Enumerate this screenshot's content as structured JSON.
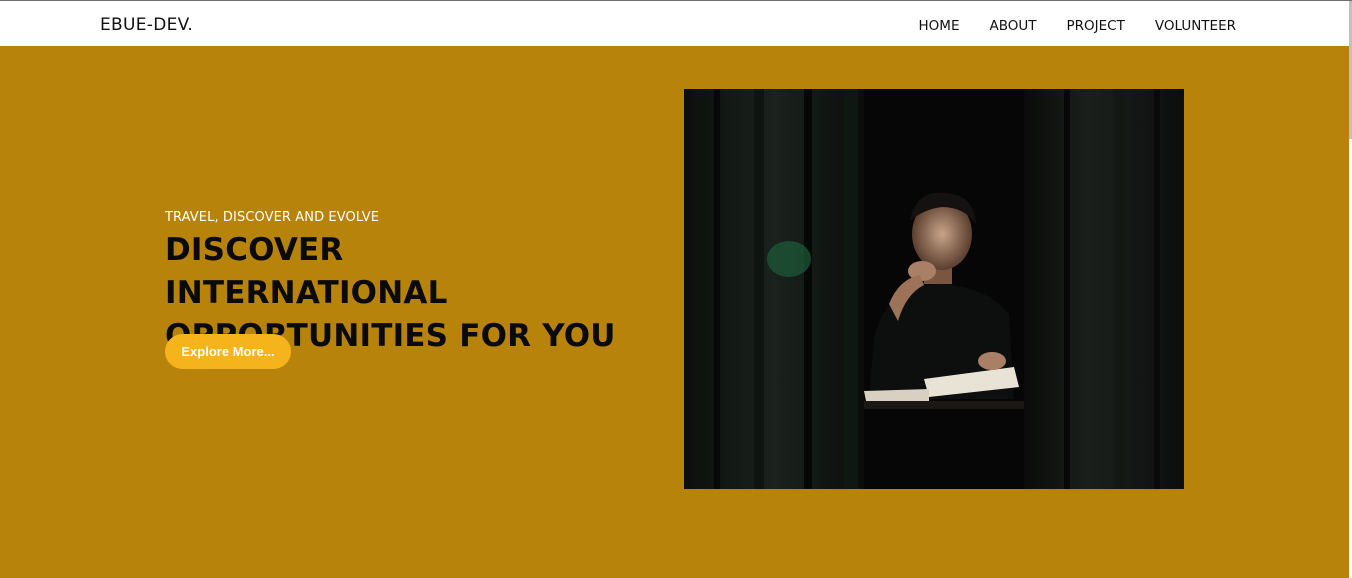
{
  "navbar": {
    "brand": "EBUE-DEV.",
    "links": [
      {
        "label": "HOME"
      },
      {
        "label": "ABOUT"
      },
      {
        "label": "PROJECT"
      },
      {
        "label": "VOLUNTEER"
      }
    ]
  },
  "hero": {
    "kicker": "TRAVEL, DISCOVER AND EVOLVE",
    "headline_line1": "DISCOVER INTERNATIONAL",
    "headline_line2": "OPPORTUNITIES FOR YOU",
    "cta_label": "Explore More..."
  },
  "colors": {
    "hero_bg": "#b8830a",
    "cta_bg": "#f5b41b",
    "nav_bg": "#ffffff"
  },
  "image": {
    "subject": "man-reading-at-night-photo"
  }
}
